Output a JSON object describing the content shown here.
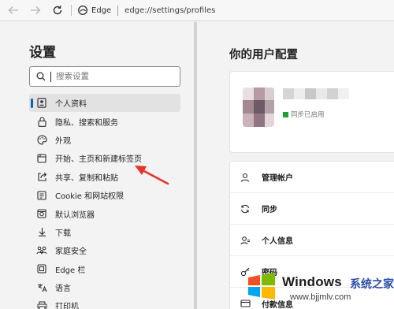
{
  "browser": {
    "app_name": "Edge",
    "url": "edge://settings/profiles"
  },
  "sidebar": {
    "title": "设置",
    "search_placeholder": "搜索设置",
    "items": [
      {
        "label": "个人资料",
        "icon": "person-icon",
        "active": true
      },
      {
        "label": "隐私、搜索和服务",
        "icon": "lock-icon"
      },
      {
        "label": "外观",
        "icon": "palette-icon"
      },
      {
        "label": "开始、主页和新建标签页",
        "icon": "home-page-icon"
      },
      {
        "label": "共享、复制和粘贴",
        "icon": "share-icon"
      },
      {
        "label": "Cookie 和网站权限",
        "icon": "site-permissions-icon"
      },
      {
        "label": "默认浏览器",
        "icon": "browser-icon"
      },
      {
        "label": "下载",
        "icon": "download-icon"
      },
      {
        "label": "家庭安全",
        "icon": "family-icon"
      },
      {
        "label": "Edge 栏",
        "icon": "edge-bar-icon"
      },
      {
        "label": "语言",
        "icon": "language-icon"
      },
      {
        "label": "打印机",
        "icon": "printer-icon"
      }
    ]
  },
  "main": {
    "title": "你的用户配置",
    "profile": {
      "sync_status": "同步已启用"
    },
    "rows": [
      {
        "label": "管理帐户",
        "icon": "account-icon"
      },
      {
        "label": "同步",
        "icon": "sync-icon"
      },
      {
        "label": "个人信息",
        "icon": "personal-info-icon"
      },
      {
        "label": "密码",
        "icon": "key-icon"
      },
      {
        "label": "付款信息",
        "icon": "payment-icon"
      }
    ]
  },
  "watermark": {
    "brand": "Windows",
    "cn_text": "系统之家",
    "url": "www.bjjmlv.com"
  },
  "colors": {
    "accent": "#0a63b8",
    "annotation_arrow": "#e8332a",
    "sync_green": "#1aa334"
  }
}
